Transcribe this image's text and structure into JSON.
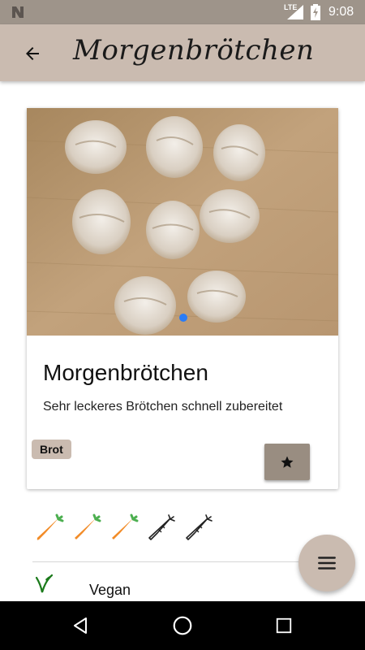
{
  "status_bar": {
    "network": "LTE",
    "time": "9:08",
    "icons": [
      "notification-n-icon",
      "signal-icon",
      "battery-charging-icon"
    ]
  },
  "app_bar": {
    "title": "Morgenbrötchen",
    "back_icon": "arrow-back-icon"
  },
  "recipe_card": {
    "image_alt": "bread-rolls-photo",
    "carousel_active_index": 0,
    "title": "Morgenbrötchen",
    "description": "Sehr leckeres Brötchen schnell zubereitet",
    "tag": "Brot",
    "favorite_icon": "star-icon"
  },
  "difficulty": {
    "icon": "carrot-icon",
    "filled": 3,
    "total": 5,
    "colors": {
      "filled": "#f28c28",
      "leaf": "#4caf50",
      "outline": "#222222"
    }
  },
  "diet": {
    "icon": "vegan-icon",
    "label": "Vegan",
    "color": "#1b7a1b"
  },
  "fab": {
    "icon": "menu-icon"
  },
  "nav_bar": {
    "icons": [
      "back-triangle-icon",
      "home-circle-icon",
      "recents-square-icon"
    ]
  },
  "theme": {
    "accent": "#cabbb0",
    "status_bar": "#9e948a",
    "button": "#998d81"
  }
}
